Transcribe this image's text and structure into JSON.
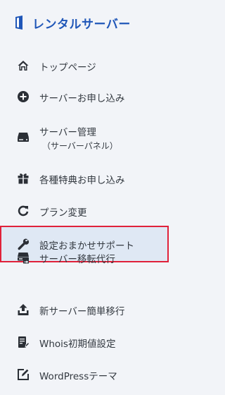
{
  "brand": {
    "name": "レンタルサーバー"
  },
  "menu": {
    "items": [
      {
        "label": "トップページ",
        "icon": "home-icon"
      },
      {
        "label": "サーバーお申し込み",
        "icon": "plus-circle-icon"
      },
      {
        "label": "サーバー管理",
        "sublabel": "（サーバーパネル）",
        "icon": "server-icon"
      },
      {
        "label": "各種特典お申し込み",
        "icon": "gift-icon"
      },
      {
        "label": "プラン変更",
        "icon": "refresh-icon"
      },
      {
        "label": "設定おまかせサポート",
        "icon": "wrench-icon",
        "active": true
      },
      {
        "label": "サーバー移転代行",
        "icon": "server-transfer-icon"
      },
      {
        "label": "新サーバー簡単移行",
        "icon": "upload-icon"
      },
      {
        "label": "Whois初期値設定",
        "icon": "document-edit-icon"
      },
      {
        "label": "WordPressテーマ",
        "icon": "edit-square-icon"
      }
    ]
  },
  "colors": {
    "accent": "#1f56b8",
    "active_bg": "#dfe8f4",
    "active_border": "#e0213a",
    "text": "#333940"
  }
}
